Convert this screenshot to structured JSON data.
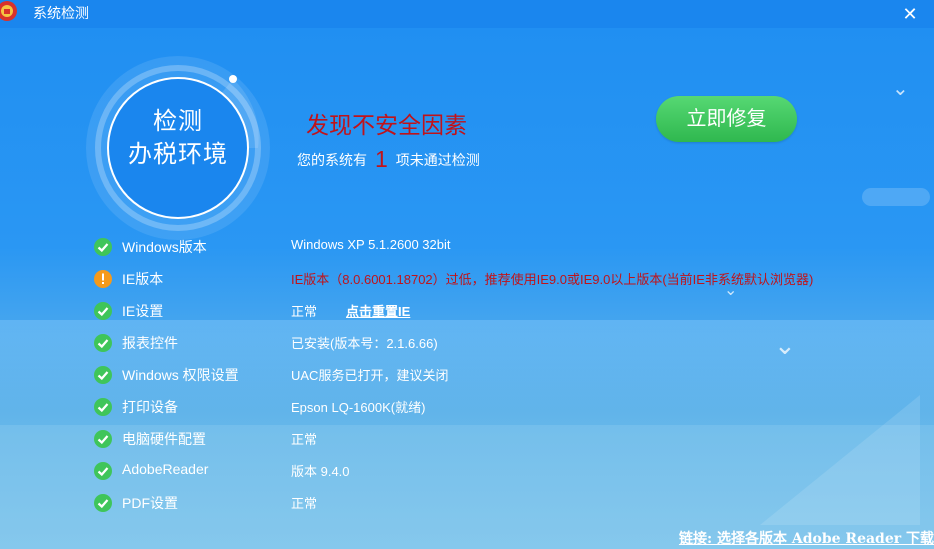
{
  "window": {
    "title": "系统检测"
  },
  "gauge": {
    "line1": "检测",
    "line2": "办税环境"
  },
  "summary": {
    "headline": "发现不安全因素",
    "prefix": "您的系统有",
    "count": "1",
    "suffix": "项未通过检测"
  },
  "fix_button": {
    "label": "立即修复"
  },
  "checks": [
    {
      "label": "Windows版本",
      "value": "Windows XP  5.1.2600  32bit",
      "status": "ok"
    },
    {
      "label": "IE版本",
      "value": "IE版本（8.0.6001.18702）过低，推荐使用IE9.0或IE9.0以上版本(当前IE非系统默认浏览器)",
      "status": "warn"
    },
    {
      "label": "IE设置",
      "value": "正常",
      "status": "ok",
      "link": "点击重置IE"
    },
    {
      "label": "报表控件",
      "value": "已安装(版本号：2.1.6.66)",
      "status": "ok"
    },
    {
      "label": "Windows 权限设置",
      "value": "UAC服务已打开，建议关闭",
      "status": "ok"
    },
    {
      "label": "打印设备",
      "value": "Epson LQ-1600K(就绪)",
      "status": "ok"
    },
    {
      "label": "电脑硬件配置",
      "value": "正常",
      "status": "ok"
    },
    {
      "label": "AdobeReader",
      "value": "版本 9.4.0",
      "status": "ok"
    },
    {
      "label": "PDF设置",
      "value": "正常",
      "status": "ok"
    }
  ],
  "footer": {
    "link": "链接: 选择各版本 Adobe Reader 下载"
  },
  "colors": {
    "ok": "#3fc55a",
    "warn": "#f59a1b",
    "alert_text": "#c0131a",
    "button": "#2fb84f"
  }
}
